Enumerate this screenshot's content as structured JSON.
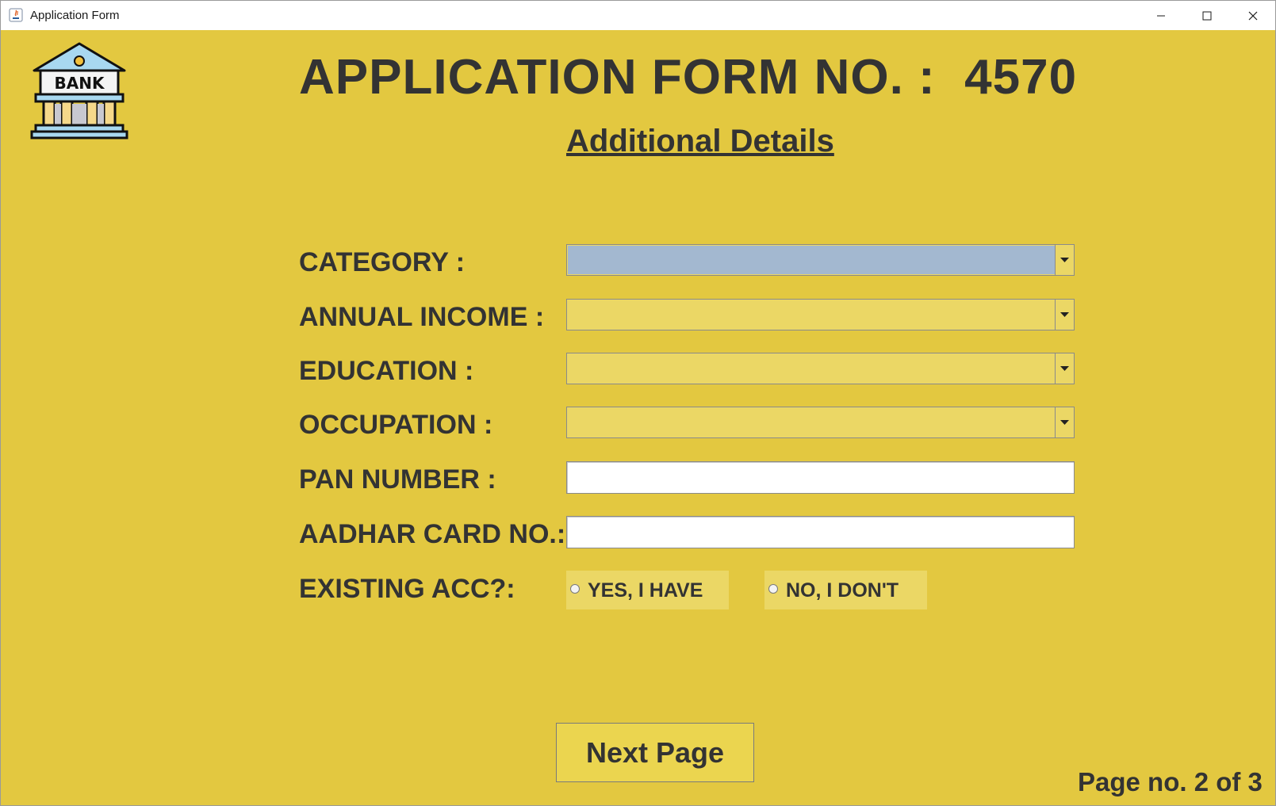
{
  "window": {
    "title": "Application Form",
    "controls": [
      "minimize-icon",
      "maximize-icon",
      "close-icon"
    ]
  },
  "logo": {
    "text": "BANK"
  },
  "header": {
    "heading": "APPLICATION FORM NO. :  4570",
    "subheading": "Additional Details"
  },
  "form": {
    "category": {
      "label": "CATEGORY :",
      "value": ""
    },
    "annual_income": {
      "label": "ANNUAL INCOME :",
      "value": ""
    },
    "education": {
      "label": "EDUCATION :",
      "value": ""
    },
    "occupation": {
      "label": "OCCUPATION :",
      "value": ""
    },
    "pan_number": {
      "label": "PAN NUMBER :",
      "value": ""
    },
    "aadhar": {
      "label": "AADHAR CARD NO.:",
      "value": ""
    },
    "existing_account": {
      "label": "EXISTING ACC?:",
      "options": [
        "YES, I HAVE",
        "NO, I DON'T"
      ],
      "selected": null
    }
  },
  "footer": {
    "next_label": "Next Page",
    "page_indicator": "Page no. 2 of 3"
  },
  "colors": {
    "background": "#e3c840",
    "field": "#ebd765",
    "focused_field": "#a3b8d0",
    "text": "#333333"
  }
}
